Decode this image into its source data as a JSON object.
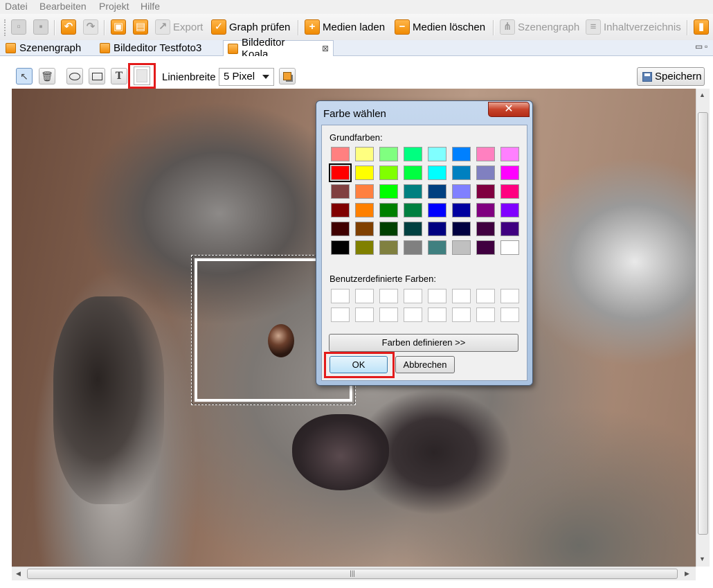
{
  "menu": [
    "Datei",
    "Bearbeiten",
    "Projekt",
    "Hilfe"
  ],
  "toolbar": {
    "export": "Export",
    "graph_pruefen": "Graph prüfen",
    "medien_laden": "Medien laden",
    "medien_loeschen": "Medien löschen",
    "szenengraph": "Szenengraph",
    "inhaltsverzeichnis": "Inhaltverzeichnis"
  },
  "tabs": [
    {
      "label": "Szenengraph",
      "active": false
    },
    {
      "label": "Bildeditor Testfoto3",
      "active": false
    },
    {
      "label": "Bildeditor Koala",
      "active": true
    }
  ],
  "editor": {
    "line_width_label": "Linienbreite",
    "line_width_value": "5 Pixel",
    "save_label": "Speichern",
    "text_tool_glyph": "T"
  },
  "dialog": {
    "title": "Farbe wählen",
    "close_glyph": "✕",
    "basic_colors_label": "Grundfarben:",
    "custom_colors_label": "Benutzerdefinierte Farben:",
    "define_colors_label": "Farben definieren >>",
    "ok_label": "OK",
    "cancel_label": "Abbrechen",
    "basic_colors": [
      [
        "#ff8080",
        "#ffff80",
        "#80ff80",
        "#00ff80",
        "#80ffff",
        "#0080ff",
        "#ff80c0",
        "#ff80ff"
      ],
      [
        "#ff0000",
        "#ffff00",
        "#80ff00",
        "#00ff40",
        "#00ffff",
        "#0080c0",
        "#8080c0",
        "#ff00ff"
      ],
      [
        "#804040",
        "#ff8040",
        "#00ff00",
        "#008080",
        "#004080",
        "#8080ff",
        "#800040",
        "#ff0080"
      ],
      [
        "#800000",
        "#ff8000",
        "#008000",
        "#008040",
        "#0000ff",
        "#0000a0",
        "#800080",
        "#8000ff"
      ],
      [
        "#400000",
        "#804000",
        "#004000",
        "#004040",
        "#000080",
        "#000040",
        "#400040",
        "#400080"
      ],
      [
        "#000000",
        "#808000",
        "#808040",
        "#808080",
        "#408080",
        "#c0c0c0",
        "#400040",
        "#ffffff"
      ]
    ],
    "selected_color": "#ff0000"
  },
  "colors": {
    "highlight": "#e31b1b",
    "dialog_frame": "#b9cde6"
  }
}
